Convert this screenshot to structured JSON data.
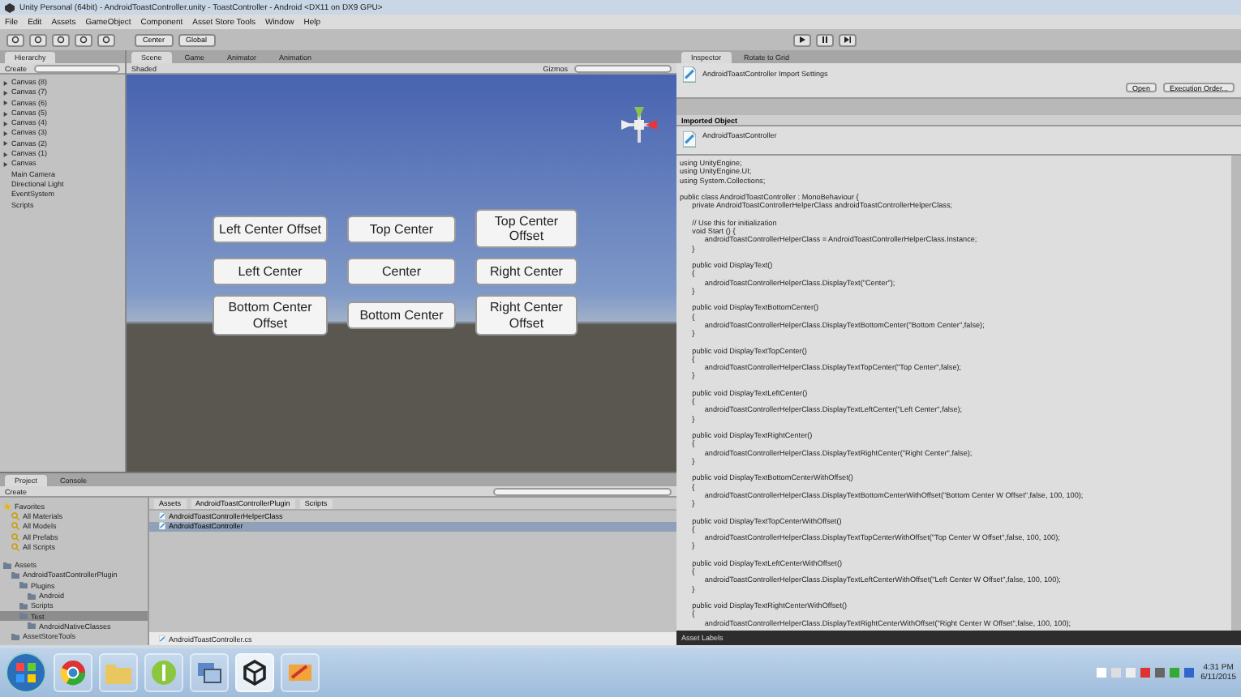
{
  "window": {
    "title": "Unity Personal (64bit) - AndroidToastController.unity - ToastController - Android <DX11 on DX9 GPU>"
  },
  "menu": [
    "File",
    "Edit",
    "Assets",
    "GameObject",
    "Component",
    "Asset Store Tools",
    "Window",
    "Help"
  ],
  "toolbar": {
    "pivot": "Center",
    "space": "Global"
  },
  "hierarchy": {
    "tab": "Hierarchy",
    "create": "Create",
    "items": [
      {
        "label": "Canvas (8)",
        "expandable": true
      },
      {
        "label": "Canvas (7)",
        "expandable": true
      },
      {
        "label": "Canvas (6)",
        "expandable": true
      },
      {
        "label": "Canvas (5)",
        "expandable": true
      },
      {
        "label": "Canvas (4)",
        "expandable": true
      },
      {
        "label": "Canvas (3)",
        "expandable": true
      },
      {
        "label": "Canvas (2)",
        "expandable": true
      },
      {
        "label": "Canvas (1)",
        "expandable": true
      },
      {
        "label": "Canvas",
        "expandable": true
      },
      {
        "label": "Main Camera",
        "expandable": false
      },
      {
        "label": "Directional Light",
        "expandable": false
      },
      {
        "label": "EventSystem",
        "expandable": false
      },
      {
        "label": "Scripts",
        "expandable": false
      }
    ]
  },
  "scene": {
    "tabs": [
      {
        "label": "Scene",
        "selected": true
      },
      {
        "label": "Game",
        "selected": false
      },
      {
        "label": "Animator",
        "selected": false
      },
      {
        "label": "Animation",
        "selected": false
      }
    ],
    "shading": "Shaded",
    "gizmos": "Gizmos",
    "buttons": [
      "Left Center Offset",
      "Top Center",
      "Top Center Offset",
      "Left Center",
      "Center",
      "Right Center",
      "Bottom Center Offset",
      "Bottom Center",
      "Right Center Offset"
    ]
  },
  "project": {
    "tabs": [
      {
        "label": "Project",
        "selected": true
      },
      {
        "label": "Console",
        "selected": false
      }
    ],
    "create": "Create",
    "tree": [
      {
        "label": "Favorites",
        "kind": "favorite",
        "selected": false,
        "children": [
          {
            "label": "All Materials",
            "kind": "search",
            "selected": false
          },
          {
            "label": "All Models",
            "kind": "search",
            "selected": false
          },
          {
            "label": "All Prefabs",
            "kind": "search",
            "selected": false
          },
          {
            "label": "All Scripts",
            "kind": "search",
            "selected": false
          }
        ]
      },
      {
        "label": "Assets",
        "kind": "folder",
        "selected": false,
        "children": [
          {
            "label": "AndroidToastControllerPlugin",
            "kind": "folder",
            "selected": false,
            "children": [
              {
                "label": "Plugins",
                "kind": "folder",
                "selected": false,
                "children": [
                  {
                    "label": "Android",
                    "kind": "folder",
                    "selected": false
                  }
                ]
              },
              {
                "label": "Scripts",
                "kind": "folder",
                "selected": false
              },
              {
                "label": "Test",
                "kind": "folder",
                "selected": true,
                "children": [
                  {
                    "label": "AndroidNativeClasses",
                    "kind": "folder",
                    "selected": false
                  }
                ]
              }
            ]
          },
          {
            "label": "AssetStoreTools",
            "kind": "folder",
            "selected": false
          }
        ]
      }
    ],
    "breadcrumb": [
      "Assets",
      "AndroidToastControllerPlugin",
      "Scripts"
    ],
    "files": [
      {
        "label": "AndroidToastControllerHelperClass",
        "selected": false
      },
      {
        "label": "AndroidToastController",
        "selected": true
      }
    ],
    "status": "AndroidToastController.cs"
  },
  "inspector": {
    "tabs": [
      {
        "label": "Inspector",
        "selected": true
      },
      {
        "label": "Rotate to Grid",
        "selected": false
      }
    ],
    "header": "AndroidToastController Import Settings",
    "open": "Open",
    "execution": "Execution Order...",
    "section": "Imported Object",
    "object": "AndroidToastController",
    "code_blocks": [
      [
        "using UnityEngine;",
        "using UnityEngine.UI;",
        "using System.Collections;"
      ],
      [
        "public class AndroidToastController : MonoBehaviour {",
        "\tprivate AndroidToastControllerHelperClass androidToastControllerHelperClass;"
      ],
      [
        "\t// Use this for initialization",
        "\tvoid Start () {",
        "\t\tandroidToastControllerHelperClass = AndroidToastControllerHelperClass.Instance;",
        "\t}"
      ],
      [
        "\tpublic void DisplayText()",
        "\t{",
        "\t\tandroidToastControllerHelperClass.DisplayText(\"Center\");",
        "\t}"
      ],
      [
        "\tpublic void DisplayTextBottomCenter()",
        "\t{",
        "\t\tandroidToastControllerHelperClass.DisplayTextBottomCenter(\"Bottom Center\",false);",
        "\t}"
      ],
      [
        "\tpublic void DisplayTextTopCenter()",
        "\t{",
        "\t\tandroidToastControllerHelperClass.DisplayTextTopCenter(\"Top Center\",false);",
        "\t}"
      ],
      [
        "\tpublic void DisplayTextLeftCenter()",
        "\t{",
        "\t\tandroidToastControllerHelperClass.DisplayTextLeftCenter(\"Left Center\",false);",
        "\t}"
      ],
      [
        "\tpublic void DisplayTextRightCenter()",
        "\t{",
        "\t\tandroidToastControllerHelperClass.DisplayTextRightCenter(\"Right Center\",false);",
        "\t}"
      ],
      [
        "\tpublic void DisplayTextBottomCenterWithOffset()",
        "\t{",
        "\t\tandroidToastControllerHelperClass.DisplayTextBottomCenterWithOffset(\"Bottom Center W Offset\",false, 100, 100);",
        "\t}"
      ],
      [
        "\tpublic void DisplayTextTopCenterWithOffset()",
        "\t{",
        "\t\tandroidToastControllerHelperClass.DisplayTextTopCenterWithOffset(\"Top Center W Offset\",false, 100, 100);",
        "\t}"
      ],
      [
        "\tpublic void DisplayTextLeftCenterWithOffset()",
        "\t{",
        "\t\tandroidToastControllerHelperClass.DisplayTextLeftCenterWithOffset(\"Left Center W Offset\",false, 100, 100);",
        "\t}"
      ],
      [
        "\tpublic void DisplayTextRightCenterWithOffset()",
        "\t{",
        "\t\tandroidToastControllerHelperClass.DisplayTextRightCenterWithOffset(\"Right Center W Offset\",false, 100, 100);"
      ]
    ],
    "footer": "Asset Labels"
  },
  "taskbar": {
    "apps": [
      {
        "kind": "browser",
        "selected": false
      },
      {
        "kind": "folder",
        "selected": false
      },
      {
        "kind": "green",
        "selected": false
      },
      {
        "kind": "network",
        "selected": false
      },
      {
        "kind": "unity",
        "selected": true
      },
      {
        "kind": "paint",
        "selected": false
      }
    ],
    "time": "4:31 PM",
    "date": "6/11/2015"
  }
}
